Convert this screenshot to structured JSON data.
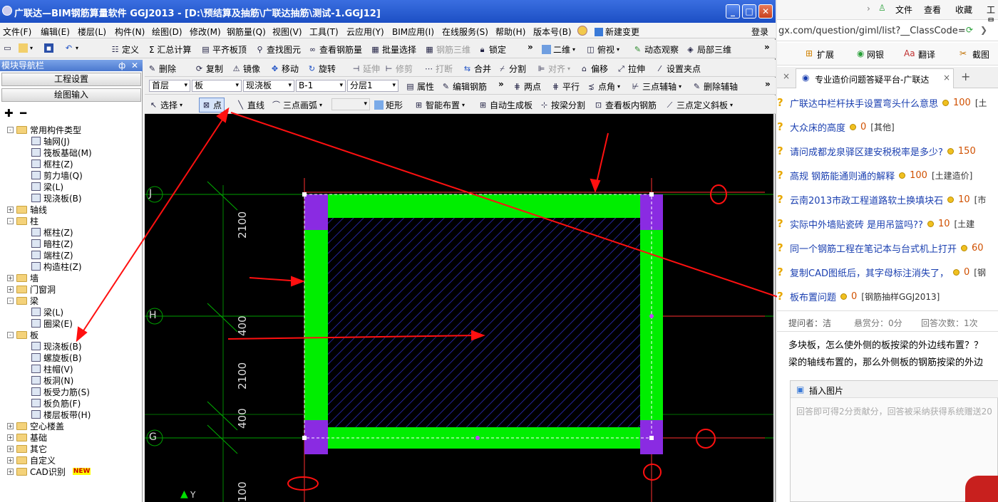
{
  "window": {
    "title": "广联达—BIM钢筋算量软件 GGJ2013 - [D:\\预结算及抽筋\\广联达抽筋\\测试-1.GGJ12]",
    "min": "_",
    "max": "□",
    "close": "✕"
  },
  "menu": [
    "文件(F)",
    "编辑(E)",
    "楼层(L)",
    "构件(N)",
    "绘图(D)",
    "修改(M)",
    "钢筋量(Q)",
    "视图(V)",
    "工具(T)",
    "云应用(Y)",
    "BIM应用(I)",
    "在线服务(S)",
    "帮助(H)",
    "版本号(B)",
    "新建变更"
  ],
  "login": "登录",
  "toolbar1": {
    "define": "定义",
    "sum": "Σ 汇总计算",
    "flat": "平齐板顶",
    "find": "查找图元",
    "view_rebar": "查看钢筋量",
    "batch": "批量选择",
    "rebar3d": "钢筋三维",
    "lock": "锁定",
    "view2d": "二维",
    "top": "俯视",
    "dynamic": "动态观察",
    "local3d": "局部三维"
  },
  "toolbar2": {
    "delete": "删除",
    "copy": "复制",
    "mirror": "镜像",
    "move": "移动",
    "rotate": "旋转",
    "extend": "延伸",
    "trim": "修剪",
    "break": "打断",
    "merge": "合并",
    "split": "分割",
    "align": "对齐",
    "offset": "偏移",
    "stretch": "拉伸",
    "set_clip": "设置夹点"
  },
  "toolbar3": {
    "floor": "首层",
    "kind": "板",
    "type": "现浇板",
    "name": "B-1",
    "layer": "分层1",
    "props": "属性",
    "edit_rebar": "编辑钢筋",
    "two_point": "两点",
    "parallel": "平行",
    "point_angle": "点角",
    "three_aux": "三点辅轴",
    "del_aux": "删除辅轴"
  },
  "toolbar4": {
    "select": "选择",
    "point": "点",
    "line": "直线",
    "arc3": "三点画弧",
    "rect": "矩形",
    "smart": "智能布置",
    "auto": "自动生成板",
    "by_beam": "按梁分割",
    "view_inner": "查看板内钢筋",
    "slope": "三点定义斜板"
  },
  "nav": {
    "title": "模块导航栏",
    "pin": "ф",
    "close": "✕",
    "btn1": "工程设置",
    "btn2": "绘图输入",
    "tree": [
      {
        "label": "常用构件类型",
        "level": 0,
        "exp": "-",
        "folder": true
      },
      {
        "label": "轴网(J)",
        "level": 1
      },
      {
        "label": "筏板基础(M)",
        "level": 1
      },
      {
        "label": "框柱(Z)",
        "level": 1
      },
      {
        "label": "剪力墙(Q)",
        "level": 1
      },
      {
        "label": "梁(L)",
        "level": 1
      },
      {
        "label": "现浇板(B)",
        "level": 1
      },
      {
        "label": "轴线",
        "level": 0,
        "exp": "+",
        "folder": true
      },
      {
        "label": "柱",
        "level": 0,
        "exp": "-",
        "folder": true
      },
      {
        "label": "框柱(Z)",
        "level": 1
      },
      {
        "label": "暗柱(Z)",
        "level": 1
      },
      {
        "label": "端柱(Z)",
        "level": 1
      },
      {
        "label": "构造柱(Z)",
        "level": 1
      },
      {
        "label": "墙",
        "level": 0,
        "exp": "+",
        "folder": true
      },
      {
        "label": "门窗洞",
        "level": 0,
        "exp": "+",
        "folder": true
      },
      {
        "label": "梁",
        "level": 0,
        "exp": "-",
        "folder": true
      },
      {
        "label": "梁(L)",
        "level": 1
      },
      {
        "label": "圈梁(E)",
        "level": 1
      },
      {
        "label": "板",
        "level": 0,
        "exp": "-",
        "folder": true
      },
      {
        "label": "现浇板(B)",
        "level": 1
      },
      {
        "label": "螺旋板(B)",
        "level": 1
      },
      {
        "label": "柱帽(V)",
        "level": 1
      },
      {
        "label": "板洞(N)",
        "level": 1
      },
      {
        "label": "板受力筋(S)",
        "level": 1
      },
      {
        "label": "板负筋(F)",
        "level": 1
      },
      {
        "label": "楼层板带(H)",
        "level": 1
      },
      {
        "label": "空心楼盖",
        "level": 0,
        "exp": "+",
        "folder": true
      },
      {
        "label": "基础",
        "level": 0,
        "exp": "+",
        "folder": true
      },
      {
        "label": "其它",
        "level": 0,
        "exp": "+",
        "folder": true
      },
      {
        "label": "自定义",
        "level": 0,
        "exp": "+",
        "folder": true
      },
      {
        "label": "CAD识别",
        "level": 0,
        "exp": "+",
        "folder": true
      }
    ],
    "new_badge": "NEW"
  },
  "canvas": {
    "axis_labels": [
      "J",
      "H",
      "G"
    ],
    "dims": [
      "2100",
      "400",
      "2100",
      "400",
      "100"
    ],
    "y_axis": "Y"
  },
  "browser": {
    "nav_text": [
      "文件",
      "查看",
      "收藏",
      "工具"
    ],
    "url": "gx.com/question/giml/list?__ClassCode=",
    "ext": [
      "扩展",
      "网银",
      "翻译",
      "截图"
    ],
    "tab": "专业造价问题答疑平台-广联达",
    "tab_close": "×",
    "new_tab": "+",
    "questions": [
      {
        "title": "广联达中栏杆扶手设置弯头什么意思",
        "score": "100",
        "tag": "[土"
      },
      {
        "title": "大众床的高度",
        "score": "0",
        "tag": "[其他]"
      },
      {
        "title": "请问成都龙泉驿区建安税税率是多少?",
        "score": "150",
        "tag": ""
      },
      {
        "title": "高规 钢筋能通则通的解释",
        "score": "100",
        "tag": "[土建造价]"
      },
      {
        "title": "云南2013市政工程道路软土换填块石",
        "score": "10",
        "tag": "[市"
      },
      {
        "title": "实际中外墙贴瓷砖 是用吊篮吗??",
        "score": "10",
        "tag": "[土建"
      },
      {
        "title": "同一个钢筋工程在笔记本与台式机上打开",
        "score": "60",
        "tag": ""
      },
      {
        "title": "复制CAD图纸后，其字母标注消失了，",
        "score": "0",
        "tag": "[钢"
      },
      {
        "title": "板布置问题",
        "score": "0",
        "tag": "[钢筋抽样GGJ2013]"
      }
    ],
    "asker": "提问者：洁",
    "reward": "悬赏分：0分",
    "answers": "回答次数：1次",
    "body1": "多块板，怎么使外侧的板按梁的外边线布置？？",
    "body2": "梁的轴线布置的，那么外侧板的钢筋按梁的外边",
    "insert_img": "插入图片",
    "answer_placeholder": "回答即可得2分贡献分，回答被采纳获得系统赠送20"
  },
  "colors": {
    "accent_green": "#00ee00",
    "purple": "#8a2be2",
    "red": "#ff0000"
  }
}
